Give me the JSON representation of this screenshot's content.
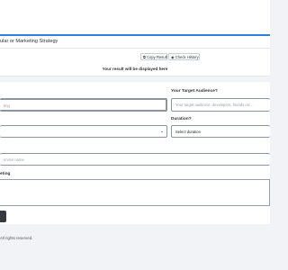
{
  "result": {
    "title": "ular or Marketing Strategy",
    "copy_label": "Copy Result",
    "check_label": "Check History",
    "note": "Your result will be displayed here"
  },
  "form": {
    "audience_label": "Your Target Audience?",
    "audience_placeholder": "Your target audience: developers, friends etc...",
    "first_input_partial": "ting",
    "duration_label": "Duration?",
    "duration_value": "Select duration",
    "name_placeholder": "ervice name",
    "textarea_label": "eting"
  },
  "footer": {
    "text": "All rights reserved."
  },
  "colors": {
    "accent": "#2f7ed8",
    "button": "#343a40"
  }
}
